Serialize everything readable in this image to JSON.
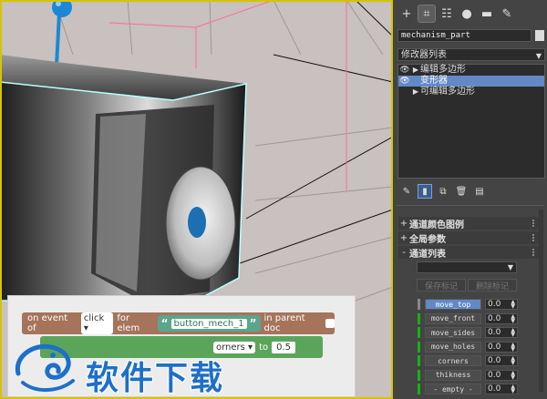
{
  "panel": {
    "tabs": [
      {
        "name": "create",
        "glyph": "+"
      },
      {
        "name": "modify",
        "glyph": "⌗"
      },
      {
        "name": "hierarchy",
        "glyph": "☷"
      },
      {
        "name": "motion",
        "glyph": "●"
      },
      {
        "name": "display",
        "glyph": "▬"
      },
      {
        "name": "utilities",
        "glyph": "✎"
      }
    ],
    "object_name": "mechanism_part",
    "modifier_list_label": "修改器列表",
    "stack": [
      {
        "label": "编辑多边形",
        "eye": true,
        "expand": true,
        "selected": false
      },
      {
        "label": "变形器",
        "eye": true,
        "expand": false,
        "selected": true
      },
      {
        "label": "可编辑多边形",
        "eye": false,
        "expand": true,
        "selected": false
      }
    ],
    "rollouts": [
      {
        "sign": "+",
        "label": "通道颜色图例"
      },
      {
        "sign": "+",
        "label": "全局参数"
      },
      {
        "sign": "-",
        "label": "通道列表"
      }
    ],
    "buttons": {
      "save": "保存标记",
      "delete": "删除标记"
    },
    "channels": [
      {
        "name": "move_top",
        "value": "0.0",
        "selected": true
      },
      {
        "name": "move_front",
        "value": "0.0",
        "selected": false
      },
      {
        "name": "move_sides",
        "value": "0.0",
        "selected": false
      },
      {
        "name": "move_holes",
        "value": "0.0",
        "selected": false
      },
      {
        "name": "corners",
        "value": "0.0",
        "selected": false
      },
      {
        "name": "thikness",
        "value": "0.0",
        "selected": false
      },
      {
        "name": "- empty -",
        "value": "0.0",
        "selected": false
      }
    ],
    "accent_color": "#6289c6",
    "channel_active_color": "#17b217"
  },
  "blockly": {
    "event_prefix": "on event of",
    "event_value": "click",
    "for_elem": "for elem",
    "elem_name": "button_mech_1",
    "in_parent": "in parent doc",
    "set_target": "orners",
    "to_label": "to",
    "to_value": "0.5"
  },
  "watermark": {
    "text": "软件下载"
  }
}
